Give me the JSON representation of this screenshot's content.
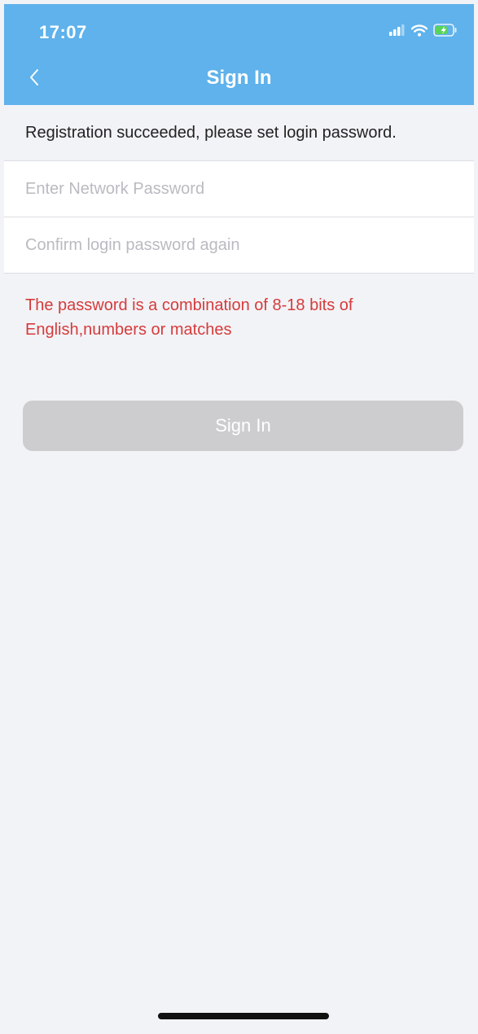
{
  "status_bar": {
    "time": "17:07",
    "icons": [
      "signal-icon",
      "wifi-icon",
      "battery-charging-icon"
    ]
  },
  "nav": {
    "back_icon": "chevron-left-icon",
    "title": "Sign In"
  },
  "message": {
    "text": "Registration succeeded, please set login password."
  },
  "form": {
    "password": {
      "value": "",
      "placeholder": "Enter Network Password"
    },
    "confirm_password": {
      "value": "",
      "placeholder": "Confirm login password again"
    },
    "hint": "The password is a combination of 8-18 bits of English,numbers or matches",
    "submit_label": "Sign In"
  },
  "colors": {
    "header": "#5fb2eb",
    "background": "#f2f3f7",
    "hint": "#d63b3b",
    "button_disabled": "#cdcdcf"
  }
}
